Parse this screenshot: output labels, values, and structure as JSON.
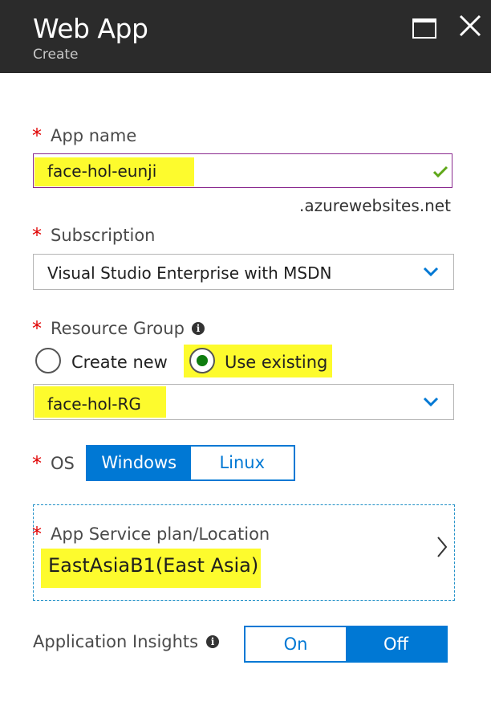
{
  "header": {
    "title": "Web App",
    "subtitle": "Create"
  },
  "app_name": {
    "label": "App name",
    "value": "face-hol-eunji",
    "suffix": ".azurewebsites.net"
  },
  "subscription": {
    "label": "Subscription",
    "value": "Visual Studio Enterprise with MSDN"
  },
  "resource_group": {
    "label": "Resource Group",
    "create_new_label": "Create new",
    "use_existing_label": "Use existing",
    "selected_option": "Use existing",
    "value": "face-hol-RG"
  },
  "os": {
    "label": "OS",
    "options": [
      "Windows",
      "Linux"
    ],
    "selected": "Windows"
  },
  "app_service_plan": {
    "label": "App Service plan/Location",
    "value": "EastAsiaB1(East Asia)"
  },
  "app_insights": {
    "label": "Application Insights",
    "options": [
      "On",
      "Off"
    ],
    "selected": "Off"
  },
  "required_marker": "*",
  "info_glyph": "i",
  "colors": {
    "accent": "#0078d4",
    "highlight": "#fdfb2d",
    "required": "#e00000",
    "valid": "#5ea718",
    "header_bg": "#2b2b2b"
  }
}
